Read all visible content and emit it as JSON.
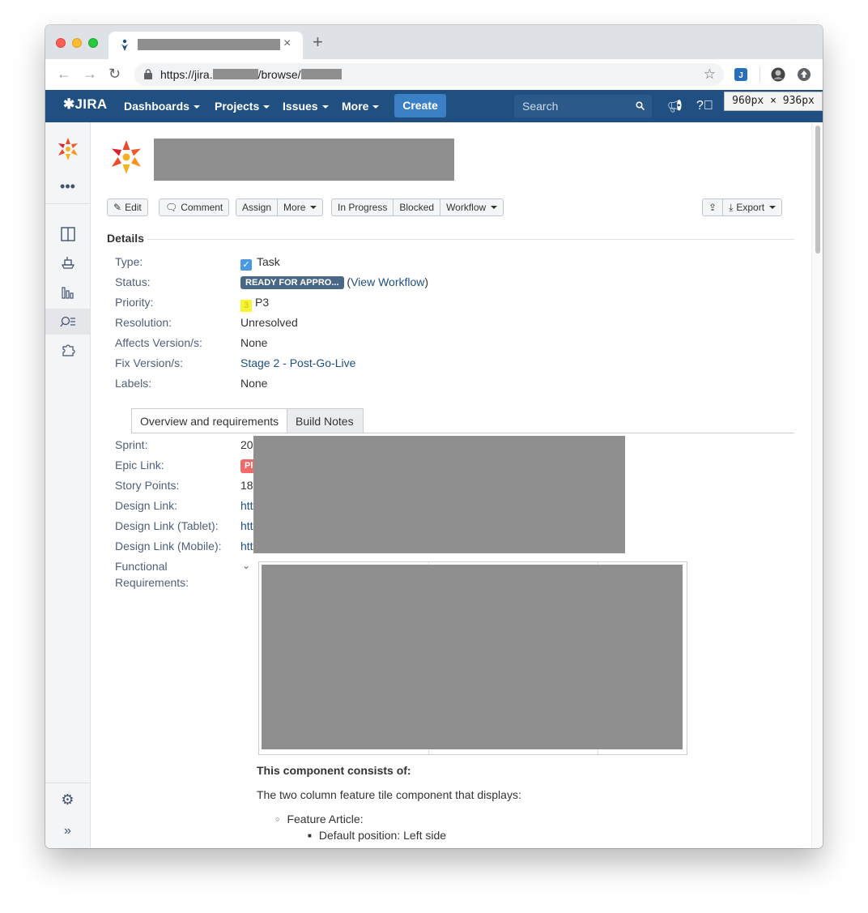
{
  "browser": {
    "url_prefix": "https://jira.",
    "url_mid": "/browse/",
    "new_tab": "+",
    "tab_close": "×"
  },
  "viewport_tooltip": "960px × 936px",
  "jira_nav": {
    "logo": "JIRA",
    "menus": [
      "Dashboards",
      "Projects",
      "Issues",
      "More"
    ],
    "create_label": "Create",
    "search_placeholder": "Search"
  },
  "toolbar": {
    "edit": "Edit",
    "comment": "Comment",
    "assign": "Assign",
    "more": "More",
    "in_progress": "In Progress",
    "blocked": "Blocked",
    "workflow": "Workflow",
    "export": "Export"
  },
  "details": {
    "heading": "Details",
    "type_label": "Type:",
    "type_value": "Task",
    "status_label": "Status:",
    "status_value": "READY FOR APPRO...",
    "view_workflow_prefix": "(",
    "view_workflow": "View Workflow",
    "view_workflow_suffix": ")",
    "priority_label": "Priority:",
    "priority_badge": "3",
    "priority_value": "P3",
    "resolution_label": "Resolution:",
    "resolution_value": "Unresolved",
    "affects_label": "Affects Version/s:",
    "affects_value": "None",
    "fix_label": "Fix Version/s:",
    "fix_value": "Stage 2 - Post-Go-Live",
    "labels_label": "Labels:",
    "labels_value": "None"
  },
  "content_tabs": [
    "Overview and requirements",
    "Build Notes"
  ],
  "fields": {
    "sprint_label": "Sprint:",
    "sprint_value": "20",
    "epic_label": "Epic Link:",
    "epic_value": "Pl",
    "story_label": "Story Points:",
    "story_value": "18",
    "design_label": "Design Link:",
    "design_value": "http",
    "design_tablet_label": "Design Link (Tablet):",
    "design_tablet_value": "http",
    "design_mobile_label": "Design Link (Mobile):",
    "design_mobile_value": "http",
    "functional_label_1": "Functional",
    "functional_label_2": "Requirements:"
  },
  "description": {
    "heading": "This component consists of:",
    "intro": "The two column feature tile component that displays:",
    "bullet_1": "Feature Article:",
    "sub_bullet_1": "Default position: Left side"
  },
  "colors": {
    "jira_nav": "#205081",
    "create_button": "#3b7fc4",
    "status_lozenge": "#4a6785",
    "link": "#205081",
    "redaction": "#8f8f8f"
  }
}
